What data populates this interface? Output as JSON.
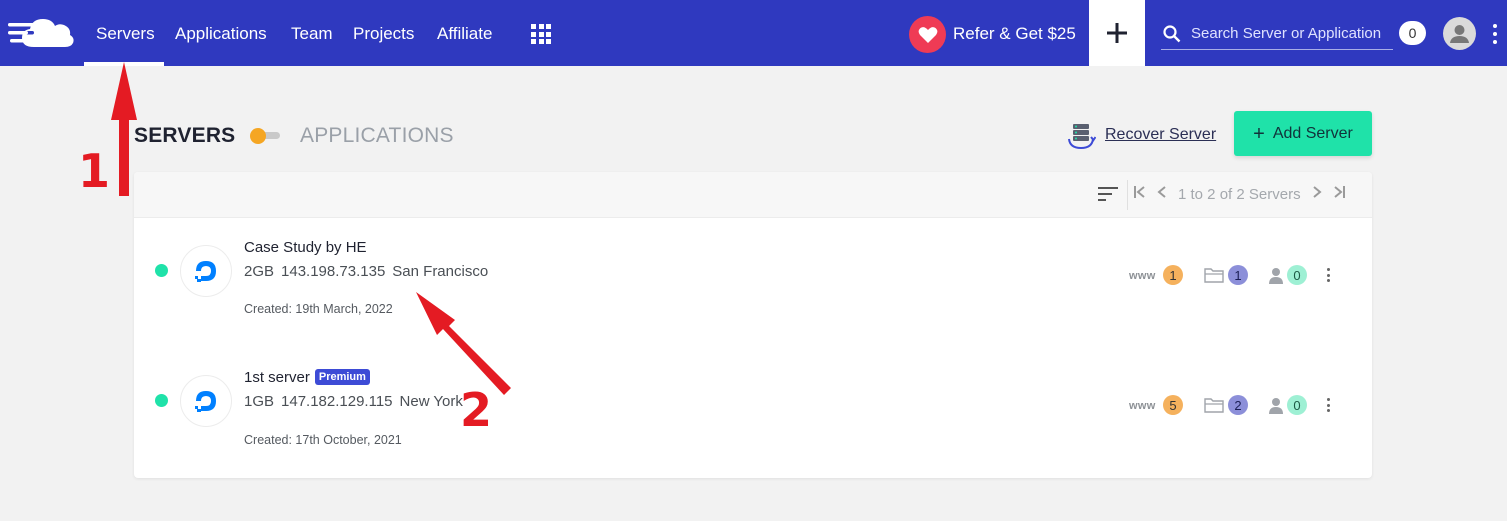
{
  "nav": {
    "items": [
      {
        "label": "Servers"
      },
      {
        "label": "Applications"
      },
      {
        "label": "Team"
      },
      {
        "label": "Projects"
      },
      {
        "label": "Affiliate"
      }
    ],
    "active": "Servers",
    "refer_label": "Refer & Get $25",
    "add_label": "+",
    "search_placeholder": "Search Server or Application",
    "notification_count": "0"
  },
  "section": {
    "servers_label": "SERVERS",
    "applications_label": "APPLICATIONS",
    "recover_label": "Recover Server",
    "add_server_label": "Add Server"
  },
  "pagination": {
    "text": "1 to 2 of 2 Servers",
    "first": "|<",
    "prev": "<",
    "next": ">",
    "last": ">|"
  },
  "servers": [
    {
      "name": "Case Study by HE",
      "premium": "",
      "size": "2GB",
      "ip": "143.198.73.135",
      "location": "San Francisco",
      "created": "Created: 19th March, 2022",
      "www_count": "1",
      "folder_count": "1",
      "user_count": "0",
      "status": "running"
    },
    {
      "name": "1st server",
      "premium": "Premium",
      "size": "1GB",
      "ip": "147.182.129.115",
      "location": "New York",
      "created": "Created: 17th October, 2021",
      "www_count": "5",
      "folder_count": "2",
      "user_count": "0",
      "status": "running"
    }
  ],
  "www_label": "www",
  "annotations": [
    {
      "label": "1"
    },
    {
      "label": "2"
    }
  ],
  "colors": {
    "topbar": "#2f39bf",
    "accent_green": "#1fe2a9",
    "annotation_red": "#e41b23",
    "badge_orange": "#f5b15d",
    "badge_purple": "#8c8fd9",
    "badge_green": "#9ef0d4"
  },
  "icons": [
    "cloudways-logo",
    "apps-grid-icon",
    "heart-icon",
    "plus-icon",
    "search-icon",
    "avatar-icon",
    "more-vertical-icon",
    "recover-server-icon",
    "sort-icon",
    "digitalocean-icon",
    "folder-icon",
    "user-icon"
  ]
}
